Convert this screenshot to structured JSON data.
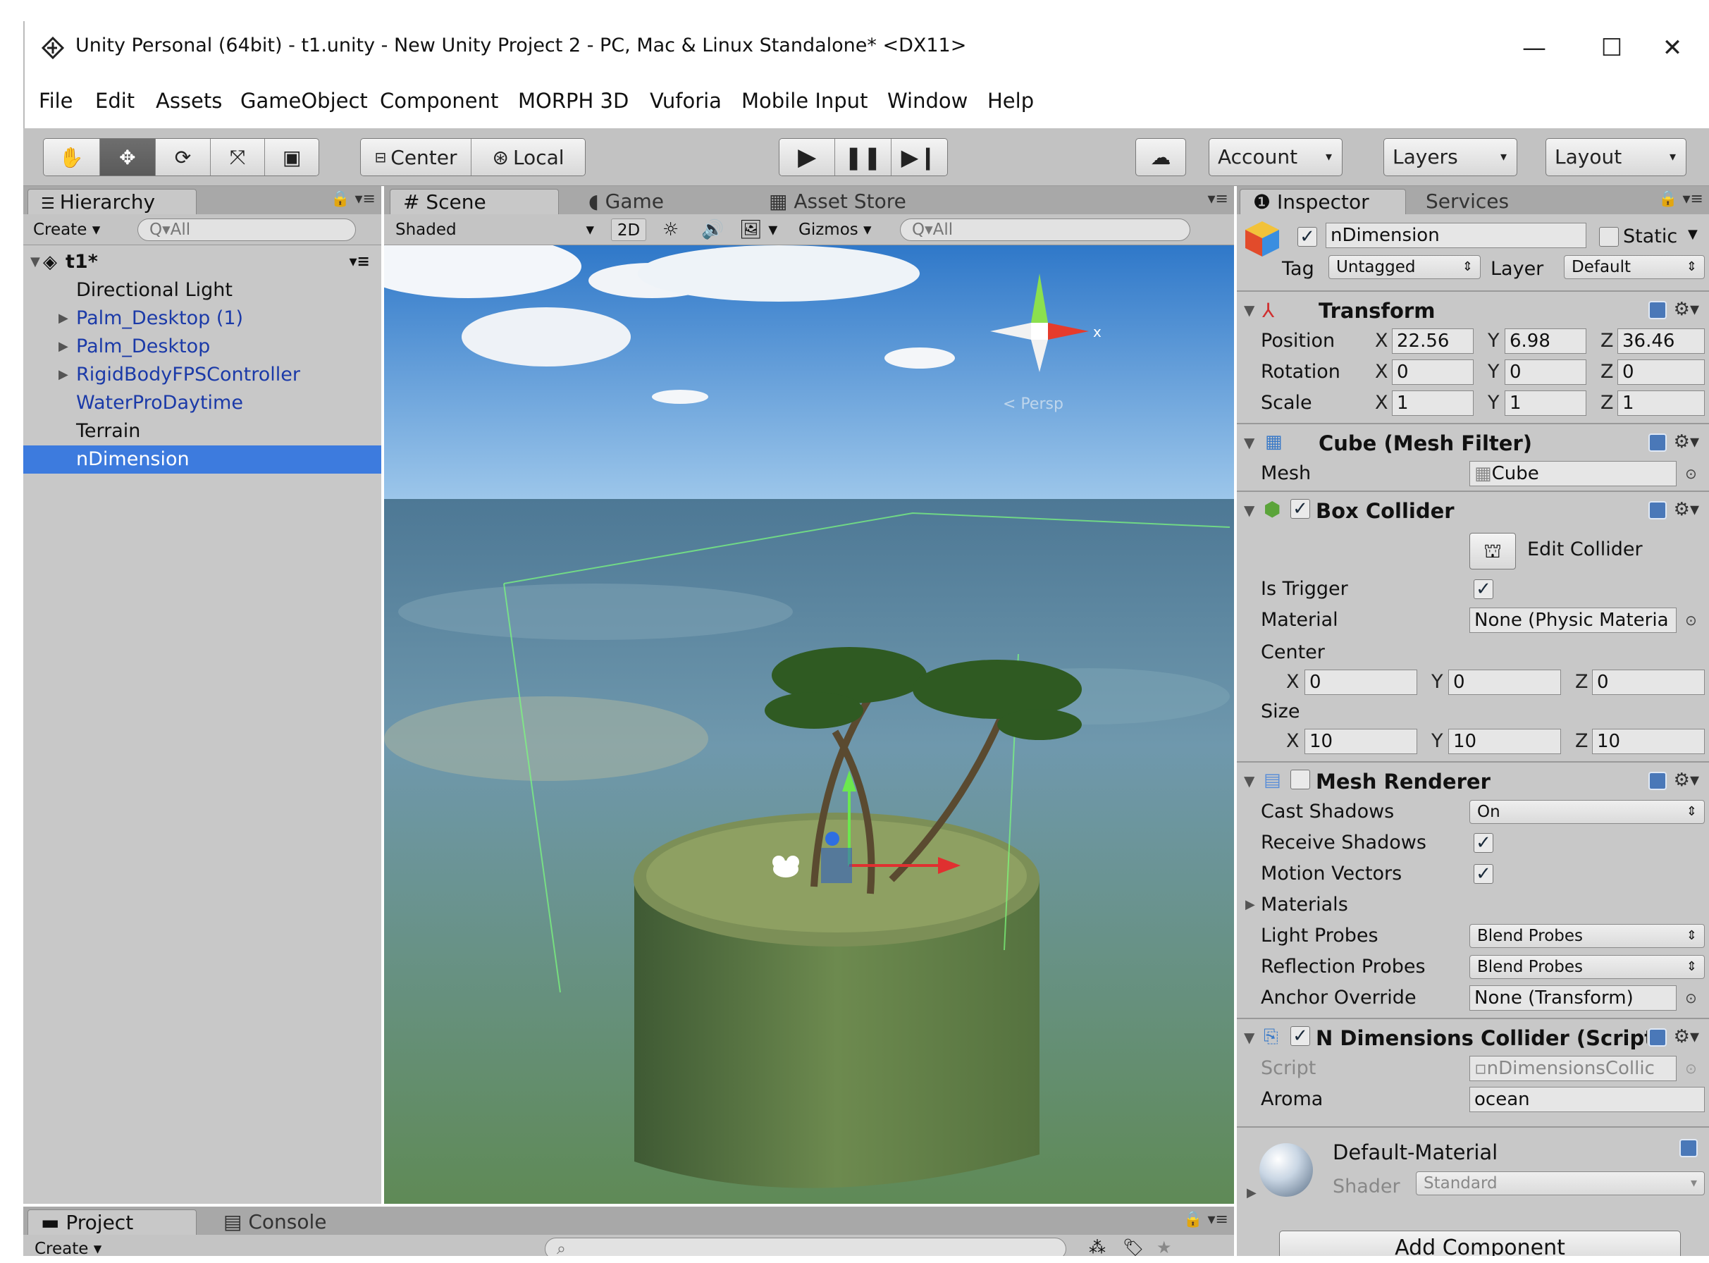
{
  "window": {
    "title": "Unity Personal (64bit) - t1.unity - New Unity Project 2 - PC, Mac & Linux Standalone* <DX11>",
    "minimize": "—",
    "maximize": "☐",
    "close": "✕"
  },
  "menu": [
    "File",
    "Edit",
    "Assets",
    "GameObject",
    "Component",
    "MORPH 3D",
    "Vuforia",
    "Mobile Input",
    "Window",
    "Help"
  ],
  "toolbar": {
    "pivot": "Center",
    "space": "Local",
    "account": "Account",
    "layers": "Layers",
    "layout": "Layout"
  },
  "hierarchy": {
    "tab": "Hierarchy",
    "create": "Create",
    "search": "Q▾All",
    "scene": "t1*",
    "items": [
      "Directional Light",
      "Palm_Desktop (1)",
      "Palm_Desktop",
      "RigidBodyFPSController",
      "WaterProDaytime",
      "Terrain",
      "nDimension"
    ]
  },
  "scene": {
    "tabs": [
      "Scene",
      "Game",
      "Asset Store"
    ],
    "shading": "Shaded",
    "mode2d": "2D",
    "gizmos": "Gizmos",
    "search": "Q▾All",
    "persp": "< Persp"
  },
  "inspector": {
    "tabs": [
      "Inspector",
      "Services"
    ],
    "object_name": "nDimension",
    "static_label": "Static",
    "tag_label": "Tag",
    "tag_value": "Untagged",
    "layer_label": "Layer",
    "layer_value": "Default",
    "transform": {
      "title": "Transform",
      "position_label": "Position",
      "px": "22.56",
      "py": "6.98",
      "pz": "36.46",
      "rotation_label": "Rotation",
      "rx": "0",
      "ry": "0",
      "rz": "0",
      "scale_label": "Scale",
      "sx": "1",
      "sy": "1",
      "sz": "1"
    },
    "mesh_filter": {
      "title": "Cube (Mesh Filter)",
      "mesh_label": "Mesh",
      "mesh_value": "Cube"
    },
    "box_collider": {
      "title": "Box Collider",
      "edit_collider": "Edit Collider",
      "is_trigger": "Is Trigger",
      "material_label": "Material",
      "material_value": "None (Physic Materia",
      "center_label": "Center",
      "cx": "0",
      "cy": "0",
      "cz": "0",
      "size_label": "Size",
      "sx": "10",
      "sy": "10",
      "sz": "10"
    },
    "mesh_renderer": {
      "title": "Mesh Renderer",
      "cast_shadows": "Cast Shadows",
      "cast_value": "On",
      "receive_shadows": "Receive Shadows",
      "motion_vectors": "Motion Vectors",
      "materials": "Materials",
      "light_probes": "Light Probes",
      "light_value": "Blend Probes",
      "reflection_probes": "Reflection Probes",
      "reflection_value": "Blend Probes",
      "anchor_override": "Anchor Override",
      "anchor_value": "None (Transform)"
    },
    "script": {
      "title": "N Dimensions Collider (Script)",
      "script_label": "Script",
      "script_value": "nDimensionsCollic",
      "aroma_label": "Aroma",
      "aroma_value": "ocean"
    },
    "material": {
      "name": "Default-Material",
      "shader_label": "Shader",
      "shader_value": "Standard"
    },
    "add_component": "Add Component"
  },
  "bottom": {
    "tabs": [
      "Project",
      "Console"
    ],
    "create": "Create"
  },
  "colors": {
    "selection": "#3d7bde",
    "prefab_text": "#1b3aa8",
    "panel_bg": "#c8c8c8"
  }
}
